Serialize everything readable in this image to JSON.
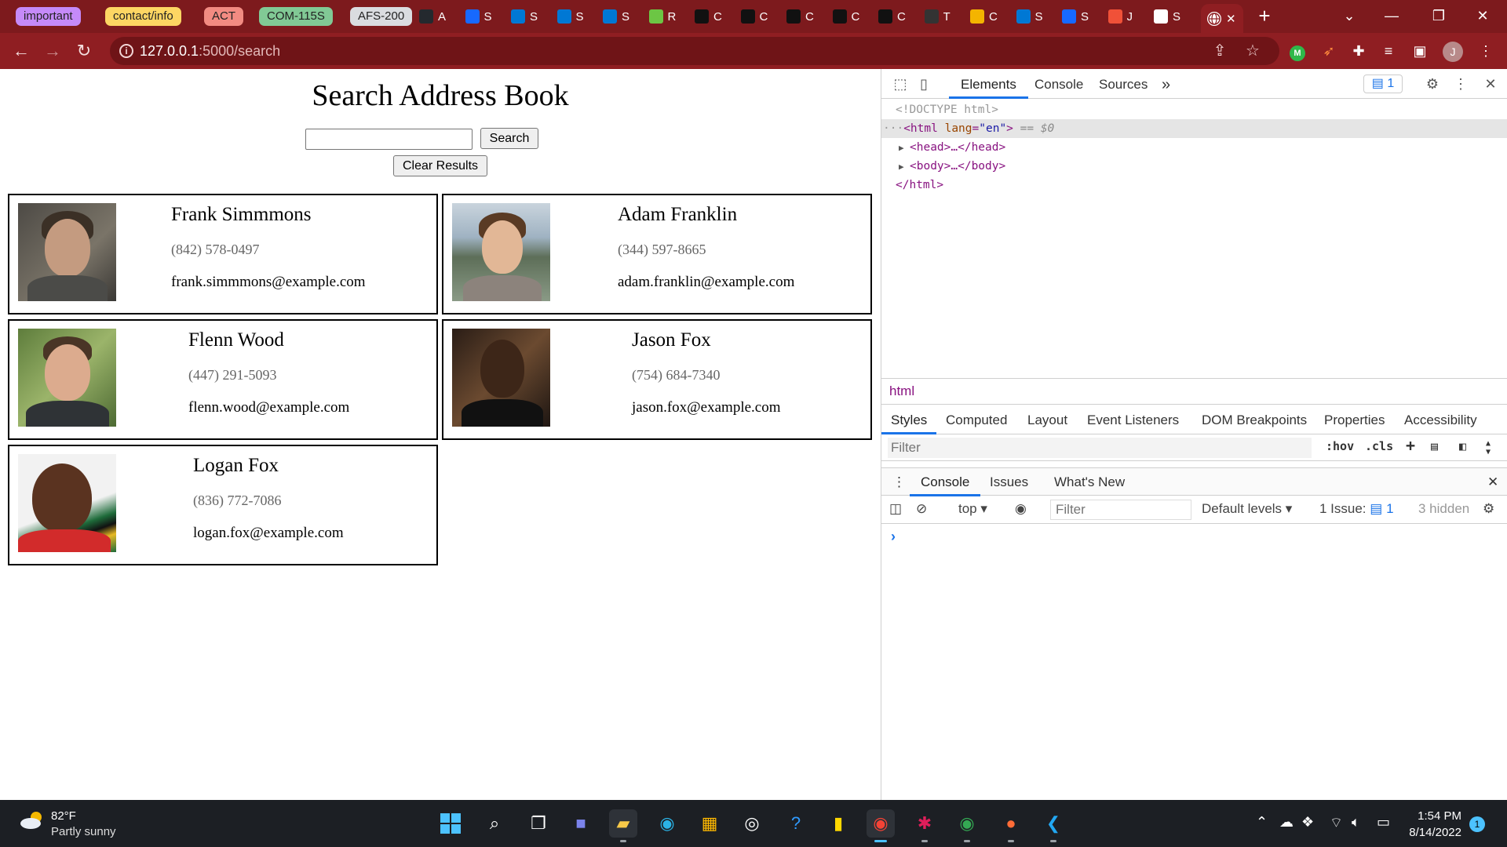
{
  "tab_groups": [
    {
      "label": "important",
      "color": "#c58af9"
    },
    {
      "label": "contact/info",
      "color": "#fdd663"
    },
    {
      "label": "ACT",
      "color": "#f28b82"
    },
    {
      "label": "COM-115S",
      "color": "#81c995"
    },
    {
      "label": "AFS-200",
      "color": "#dadce0"
    }
  ],
  "mini_tabs": [
    {
      "letter": "A",
      "icon": "github-icon",
      "color": "#24292e"
    },
    {
      "letter": "S",
      "icon": "behance-icon",
      "color": "#1769ff"
    },
    {
      "letter": "S",
      "icon": "azure-devops-icon",
      "color": "#0078d4"
    },
    {
      "letter": "S",
      "icon": "azure-devops-icon",
      "color": "#0078d4"
    },
    {
      "letter": "S",
      "icon": "azure-devops-icon",
      "color": "#0078d4"
    },
    {
      "letter": "R",
      "icon": "green-smiley-icon",
      "color": "#6cc644"
    },
    {
      "letter": "C",
      "icon": "moon-icon",
      "color": "#111111"
    },
    {
      "letter": "C",
      "icon": "moon-icon",
      "color": "#111111"
    },
    {
      "letter": "C",
      "icon": "moon-icon",
      "color": "#111111"
    },
    {
      "letter": "C",
      "icon": "moon-icon",
      "color": "#111111"
    },
    {
      "letter": "C",
      "icon": "moon-icon",
      "color": "#111111"
    },
    {
      "letter": "T",
      "icon": "trash-icon",
      "color": "#333333"
    },
    {
      "letter": "C",
      "icon": "lucidchart-icon",
      "color": "#f4b400"
    },
    {
      "letter": "S",
      "icon": "azure-devops-icon",
      "color": "#0078d4"
    },
    {
      "letter": "S",
      "icon": "behance-icon",
      "color": "#1769ff"
    },
    {
      "letter": "J",
      "icon": "swift-icon",
      "color": "#f05138"
    },
    {
      "letter": "S",
      "icon": "gear-icon",
      "color": "#ffffff"
    }
  ],
  "active_tab": {
    "letter": "",
    "icon": "globe-icon"
  },
  "window_controls": {
    "tab_search": "⌄",
    "minimize": "—",
    "restore": "❐",
    "close": "✕"
  },
  "browser": {
    "url_host": "127.0.0.1",
    "url_rest": ":5000/search"
  },
  "page": {
    "title": "Search Address Book",
    "search_value": "",
    "search_button": "Search",
    "clear_button": "Clear Results",
    "contacts": [
      {
        "name": "Frank Simmmons",
        "phone": "(842) 578-0497",
        "email": "frank.simmmons@example.com"
      },
      {
        "name": "Adam Franklin",
        "phone": "(344) 597-8665",
        "email": "adam.franklin@example.com"
      },
      {
        "name": "Flenn Wood",
        "phone": "(447) 291-5093",
        "email": "flenn.wood@example.com"
      },
      {
        "name": "Jason Fox",
        "phone": "(754) 684-7340",
        "email": "jason.fox@example.com"
      },
      {
        "name": "Logan Fox",
        "phone": "(836) 772-7086",
        "email": "logan.fox@example.com"
      }
    ]
  },
  "devtools": {
    "tabs": [
      "Elements",
      "Console",
      "Sources"
    ],
    "more": "»",
    "issues_count": "1",
    "dom": {
      "doctype": "<!DOCTYPE html>",
      "html_open_tag": "<html",
      "html_attr": "lang",
      "html_attr_val": "\"en\"",
      "html_close_bracket": ">",
      "selected_marker": "== $0",
      "head": "<head>…</head>",
      "body": "<body>…</body>",
      "html_close": "</html>"
    },
    "breadcrumb": "html",
    "style_tabs": [
      "Styles",
      "Computed",
      "Layout",
      "Event Listeners",
      "DOM Breakpoints",
      "Properties",
      "Accessibility"
    ],
    "styles_filter_placeholder": "Filter",
    "hov": ":hov",
    "cls": ".cls",
    "drawer_tabs": [
      "Console",
      "Issues",
      "What's New"
    ],
    "console": {
      "context": "top",
      "filter_placeholder": "Filter",
      "levels": "Default levels",
      "issues_label": "1 Issue:",
      "issues_num": "1",
      "hidden": "3 hidden"
    }
  },
  "taskbar": {
    "temp": "82°F",
    "condition": "Partly sunny",
    "time": "1:54 PM",
    "date": "8/14/2022",
    "notifications": "1"
  }
}
